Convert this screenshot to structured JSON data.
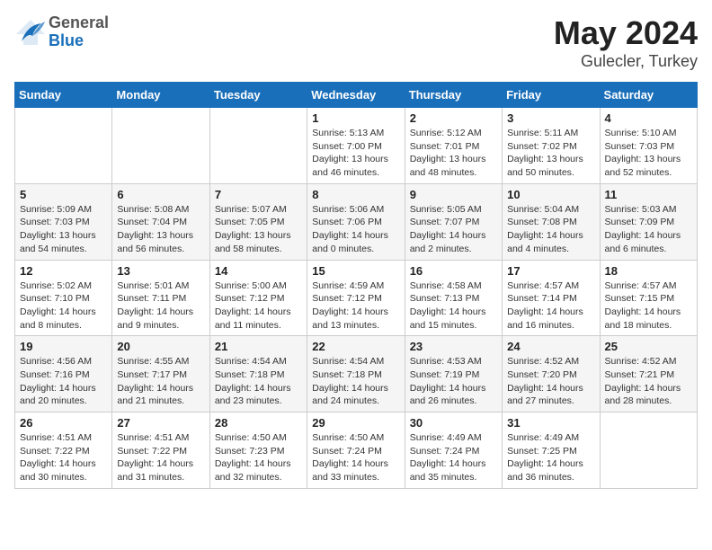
{
  "header": {
    "logo_general": "General",
    "logo_blue": "Blue",
    "title": "May 2024",
    "subtitle": "Gulecler, Turkey"
  },
  "weekdays": [
    "Sunday",
    "Monday",
    "Tuesday",
    "Wednesday",
    "Thursday",
    "Friday",
    "Saturday"
  ],
  "weeks": [
    [
      {
        "day": "",
        "info": ""
      },
      {
        "day": "",
        "info": ""
      },
      {
        "day": "",
        "info": ""
      },
      {
        "day": "1",
        "info": "Sunrise: 5:13 AM\nSunset: 7:00 PM\nDaylight: 13 hours\nand 46 minutes."
      },
      {
        "day": "2",
        "info": "Sunrise: 5:12 AM\nSunset: 7:01 PM\nDaylight: 13 hours\nand 48 minutes."
      },
      {
        "day": "3",
        "info": "Sunrise: 5:11 AM\nSunset: 7:02 PM\nDaylight: 13 hours\nand 50 minutes."
      },
      {
        "day": "4",
        "info": "Sunrise: 5:10 AM\nSunset: 7:03 PM\nDaylight: 13 hours\nand 52 minutes."
      }
    ],
    [
      {
        "day": "5",
        "info": "Sunrise: 5:09 AM\nSunset: 7:03 PM\nDaylight: 13 hours\nand 54 minutes."
      },
      {
        "day": "6",
        "info": "Sunrise: 5:08 AM\nSunset: 7:04 PM\nDaylight: 13 hours\nand 56 minutes."
      },
      {
        "day": "7",
        "info": "Sunrise: 5:07 AM\nSunset: 7:05 PM\nDaylight: 13 hours\nand 58 minutes."
      },
      {
        "day": "8",
        "info": "Sunrise: 5:06 AM\nSunset: 7:06 PM\nDaylight: 14 hours\nand 0 minutes."
      },
      {
        "day": "9",
        "info": "Sunrise: 5:05 AM\nSunset: 7:07 PM\nDaylight: 14 hours\nand 2 minutes."
      },
      {
        "day": "10",
        "info": "Sunrise: 5:04 AM\nSunset: 7:08 PM\nDaylight: 14 hours\nand 4 minutes."
      },
      {
        "day": "11",
        "info": "Sunrise: 5:03 AM\nSunset: 7:09 PM\nDaylight: 14 hours\nand 6 minutes."
      }
    ],
    [
      {
        "day": "12",
        "info": "Sunrise: 5:02 AM\nSunset: 7:10 PM\nDaylight: 14 hours\nand 8 minutes."
      },
      {
        "day": "13",
        "info": "Sunrise: 5:01 AM\nSunset: 7:11 PM\nDaylight: 14 hours\nand 9 minutes."
      },
      {
        "day": "14",
        "info": "Sunrise: 5:00 AM\nSunset: 7:12 PM\nDaylight: 14 hours\nand 11 minutes."
      },
      {
        "day": "15",
        "info": "Sunrise: 4:59 AM\nSunset: 7:12 PM\nDaylight: 14 hours\nand 13 minutes."
      },
      {
        "day": "16",
        "info": "Sunrise: 4:58 AM\nSunset: 7:13 PM\nDaylight: 14 hours\nand 15 minutes."
      },
      {
        "day": "17",
        "info": "Sunrise: 4:57 AM\nSunset: 7:14 PM\nDaylight: 14 hours\nand 16 minutes."
      },
      {
        "day": "18",
        "info": "Sunrise: 4:57 AM\nSunset: 7:15 PM\nDaylight: 14 hours\nand 18 minutes."
      }
    ],
    [
      {
        "day": "19",
        "info": "Sunrise: 4:56 AM\nSunset: 7:16 PM\nDaylight: 14 hours\nand 20 minutes."
      },
      {
        "day": "20",
        "info": "Sunrise: 4:55 AM\nSunset: 7:17 PM\nDaylight: 14 hours\nand 21 minutes."
      },
      {
        "day": "21",
        "info": "Sunrise: 4:54 AM\nSunset: 7:18 PM\nDaylight: 14 hours\nand 23 minutes."
      },
      {
        "day": "22",
        "info": "Sunrise: 4:54 AM\nSunset: 7:18 PM\nDaylight: 14 hours\nand 24 minutes."
      },
      {
        "day": "23",
        "info": "Sunrise: 4:53 AM\nSunset: 7:19 PM\nDaylight: 14 hours\nand 26 minutes."
      },
      {
        "day": "24",
        "info": "Sunrise: 4:52 AM\nSunset: 7:20 PM\nDaylight: 14 hours\nand 27 minutes."
      },
      {
        "day": "25",
        "info": "Sunrise: 4:52 AM\nSunset: 7:21 PM\nDaylight: 14 hours\nand 28 minutes."
      }
    ],
    [
      {
        "day": "26",
        "info": "Sunrise: 4:51 AM\nSunset: 7:22 PM\nDaylight: 14 hours\nand 30 minutes."
      },
      {
        "day": "27",
        "info": "Sunrise: 4:51 AM\nSunset: 7:22 PM\nDaylight: 14 hours\nand 31 minutes."
      },
      {
        "day": "28",
        "info": "Sunrise: 4:50 AM\nSunset: 7:23 PM\nDaylight: 14 hours\nand 32 minutes."
      },
      {
        "day": "29",
        "info": "Sunrise: 4:50 AM\nSunset: 7:24 PM\nDaylight: 14 hours\nand 33 minutes."
      },
      {
        "day": "30",
        "info": "Sunrise: 4:49 AM\nSunset: 7:24 PM\nDaylight: 14 hours\nand 35 minutes."
      },
      {
        "day": "31",
        "info": "Sunrise: 4:49 AM\nSunset: 7:25 PM\nDaylight: 14 hours\nand 36 minutes."
      },
      {
        "day": "",
        "info": ""
      }
    ]
  ]
}
